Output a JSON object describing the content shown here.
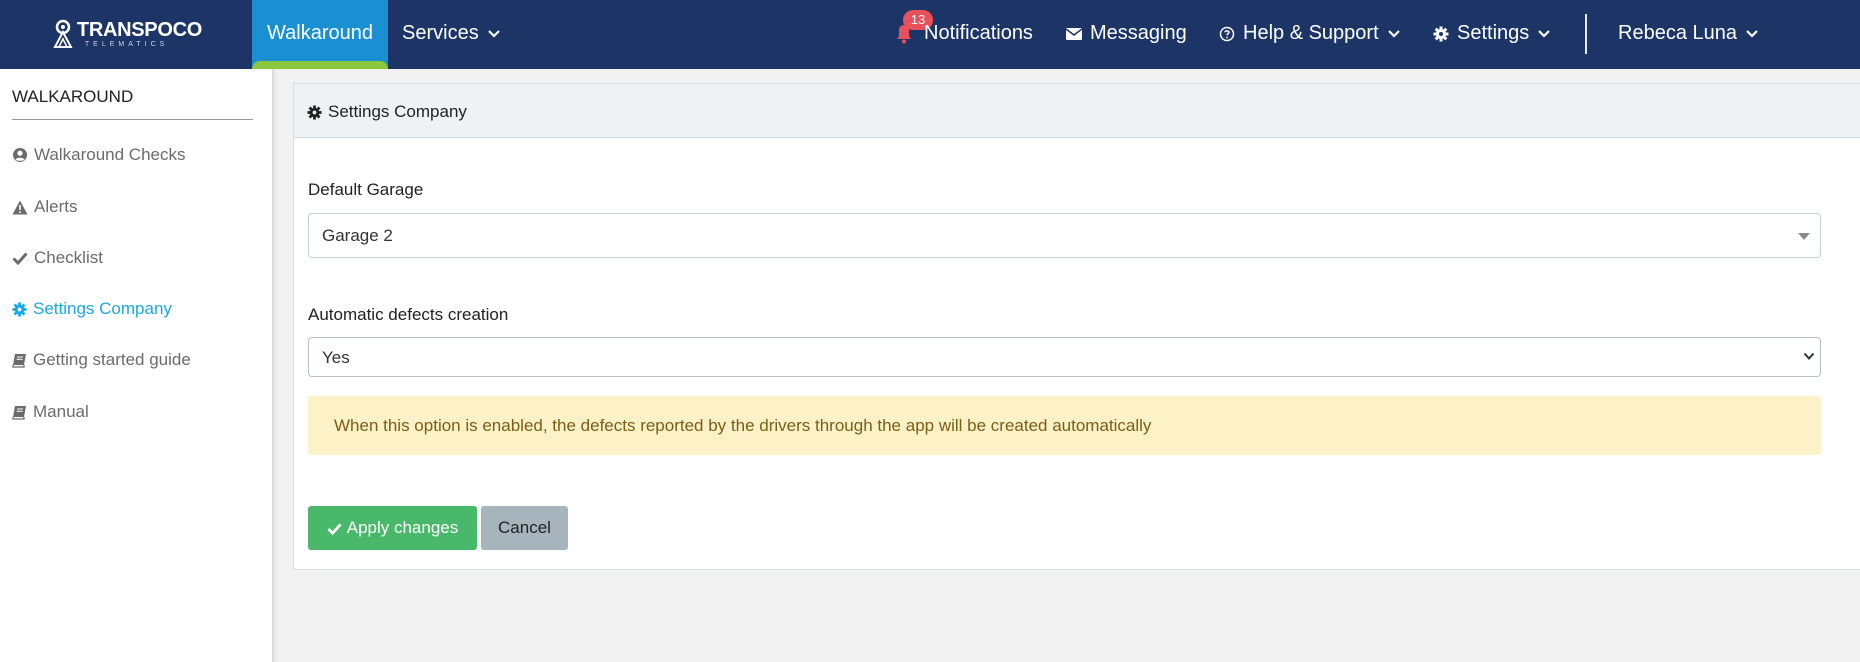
{
  "app": {
    "brand": "TRANSPOCO",
    "brand_sub": "TELEMATICS"
  },
  "topnav": {
    "active_tab": "Walkaround",
    "services": "Services",
    "notifications": "Notifications",
    "notifications_count": "13",
    "messaging": "Messaging",
    "help": "Help & Support",
    "settings": "Settings",
    "user": "Rebeca Luna"
  },
  "sidebar": {
    "title": "WALKAROUND",
    "items": [
      {
        "label": "Walkaround Checks",
        "icon": "user-circle-icon"
      },
      {
        "label": "Alerts",
        "icon": "warning-icon"
      },
      {
        "label": "Checklist",
        "icon": "check-icon"
      },
      {
        "label": "Settings Company",
        "icon": "gear-icon",
        "active": true
      },
      {
        "label": "Getting started guide",
        "icon": "book-icon"
      },
      {
        "label": "Manual",
        "icon": "book-icon"
      }
    ]
  },
  "panel": {
    "title": "Settings Company",
    "default_garage_label": "Default Garage",
    "default_garage_value": "Garage 2",
    "auto_defects_label": "Automatic defects creation",
    "auto_defects_value": "Yes",
    "info_text": "When this option is enabled, the defects reported by the drivers through the app will be created automatically",
    "apply_label": "Apply changes",
    "cancel_label": "Cancel"
  },
  "colors": {
    "navbar": "#1c3566",
    "active_tab": "#1a8fd1",
    "active_tab_underline": "#8cc63f",
    "sidebar_active": "#18a8e0",
    "apply_button": "#49b86a",
    "cancel_button": "#a6b4bd",
    "alert_bg": "#fdf1c8",
    "badge": "#e8505b"
  }
}
